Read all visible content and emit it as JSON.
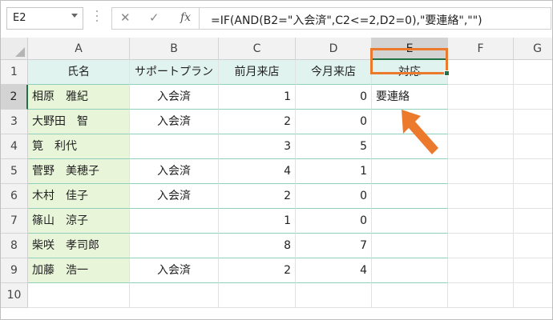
{
  "formula_bar": {
    "name_box": "E2",
    "cancel_icon": "✕",
    "enter_icon": "✓",
    "fx_label": "fx",
    "formula": "=IF(AND(B2=\"入会済\",C2<=2,D2=0),\"要連絡\",\"\")"
  },
  "columns": [
    "A",
    "B",
    "C",
    "D",
    "E",
    "F",
    "G"
  ],
  "rows": [
    "1",
    "2",
    "3",
    "4",
    "5",
    "6",
    "7",
    "8",
    "9",
    "10"
  ],
  "table": {
    "headers": [
      "氏名",
      "サポートプラン",
      "前月来店",
      "今月来店",
      "対応"
    ],
    "data": [
      {
        "name": "相原　雅紀",
        "plan": "入会済",
        "prev": "1",
        "curr": "0",
        "action": "要連絡"
      },
      {
        "name": "大野田　智",
        "plan": "入会済",
        "prev": "2",
        "curr": "0",
        "action": ""
      },
      {
        "name": "筧　利代",
        "plan": "",
        "prev": "3",
        "curr": "5",
        "action": ""
      },
      {
        "name": "菅野　美穂子",
        "plan": "入会済",
        "prev": "4",
        "curr": "1",
        "action": ""
      },
      {
        "name": "木村　佳子",
        "plan": "入会済",
        "prev": "2",
        "curr": "0",
        "action": ""
      },
      {
        "name": "篠山　涼子",
        "plan": "",
        "prev": "1",
        "curr": "0",
        "action": ""
      },
      {
        "name": "柴咲　孝司郎",
        "plan": "",
        "prev": "8",
        "curr": "7",
        "action": ""
      },
      {
        "name": "加藤　浩一",
        "plan": "入会済",
        "prev": "2",
        "curr": "4",
        "action": ""
      }
    ]
  },
  "colors": {
    "header_fill": "#e1f3ee",
    "name_fill": "#e8f5d8",
    "selection_border": "#ec7a2c",
    "arrow": "#ec7a2c",
    "excel_green": "#217346"
  }
}
